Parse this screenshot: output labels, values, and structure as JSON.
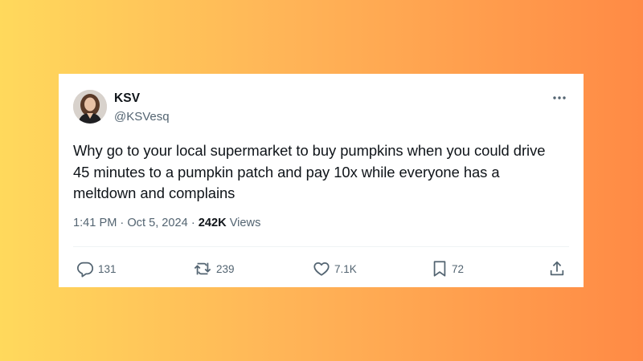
{
  "tweet": {
    "author": {
      "display_name": "KSV",
      "handle": "@KSVesq",
      "avatar_icon": "profile-photo"
    },
    "text": "Why go to your local supermarket to buy pumpkins when you could drive\n45 minutes to a pumpkin patch and pay 10x while everyone has a\nmeltdown and complains",
    "timestamp": "1:41 PM · Oct 5, 2024",
    "separator": " · ",
    "views_count": "242K",
    "views_label": " Views",
    "actions": {
      "replies": "131",
      "retweets": "239",
      "likes": "7.1K",
      "bookmarks": "72"
    },
    "icons": {
      "more": "more-horizontal-icon",
      "reply": "reply-icon",
      "retweet": "retweet-icon",
      "like": "heart-icon",
      "bookmark": "bookmark-icon",
      "share": "share-icon"
    }
  },
  "colors": {
    "background_gradient": [
      "#FFD95C",
      "#FFB457",
      "#FF8A45"
    ],
    "text_primary": "#0f1419",
    "text_secondary": "#536471",
    "card": "#ffffff"
  }
}
